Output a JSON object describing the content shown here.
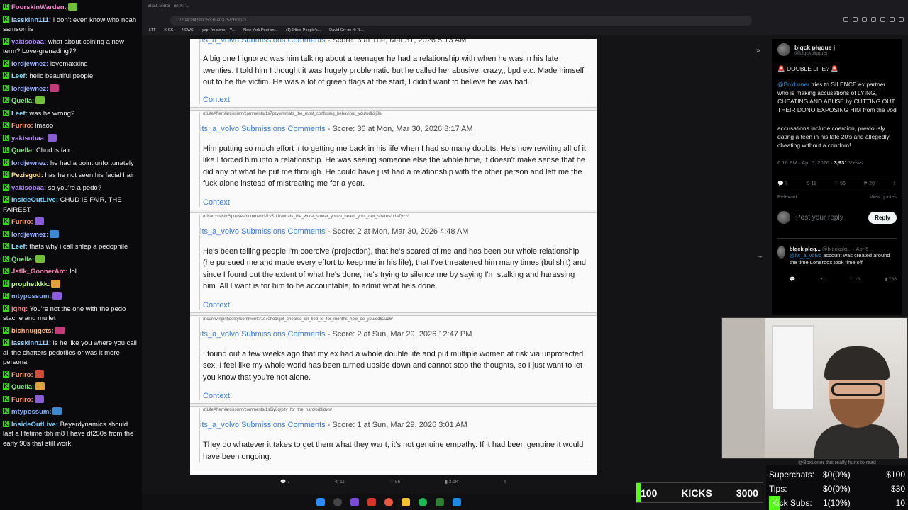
{
  "chat": {
    "messages": [
      {
        "user": "FoorskinWarden",
        "color": "#ff7fd0",
        "text": ""
      },
      {
        "user": "lasskinn111",
        "color": "#9ad0ff",
        "text": "I don't even know who noah samson is"
      },
      {
        "user": "yakisobaa",
        "color": "#b58cff",
        "text": "what about coining a new term? Love-grenading??"
      },
      {
        "user": "lordjewnez",
        "color": "#9ab0ff",
        "text": "lovemaxxing"
      },
      {
        "user": "Leef",
        "color": "#7fe0ff",
        "text": "hello beautiful people"
      },
      {
        "user": "lordjewnez",
        "color": "#9ab0ff",
        "text": ""
      },
      {
        "user": "Quella",
        "color": "#7fe07f",
        "text": ""
      },
      {
        "user": "Leef",
        "color": "#7fe0ff",
        "text": "was he wrong?"
      },
      {
        "user": "Furiro",
        "color": "#ff9a6a",
        "text": "lmaoo"
      },
      {
        "user": "yakisobaa",
        "color": "#b58cff",
        "text": ""
      },
      {
        "user": "Quella",
        "color": "#7fe07f",
        "text": "Chud is fair"
      },
      {
        "user": "lordjewnez",
        "color": "#9ab0ff",
        "text": "he had a point unfortunately"
      },
      {
        "user": "Pezisgod",
        "color": "#ffd97f",
        "text": "has he not seen his facial hair"
      },
      {
        "user": "yakisobaa",
        "color": "#b58cff",
        "text": "so you're a pedo?"
      },
      {
        "user": "InsideOutLive",
        "color": "#6ad0ff",
        "text": "CHUD IS FAIR, THE FAIREST"
      },
      {
        "user": "Furiro",
        "color": "#ff9a6a",
        "text": ""
      },
      {
        "user": "lordjewnez",
        "color": "#9ab0ff",
        "text": ""
      },
      {
        "user": "Leef",
        "color": "#7fe0ff",
        "text": "thats why i call shlep a pedophile"
      },
      {
        "user": "Quella",
        "color": "#7fe07f",
        "text": ""
      },
      {
        "user": "Jstlk_GoonerArc",
        "color": "#ff7fb0",
        "text": "lol"
      },
      {
        "user": "prophetkkk",
        "color": "#c0ff7f",
        "text": ""
      },
      {
        "user": "mtypossum",
        "color": "#7fb0ff",
        "text": ""
      },
      {
        "user": "jqhq",
        "color": "#ff7f7f",
        "text": "You're not the one with the pedo stache and mullet"
      },
      {
        "user": "bichnuggets",
        "color": "#ffb07f",
        "text": ""
      },
      {
        "user": "lasskinn111",
        "color": "#9ad0ff",
        "text": "is he like you where you call all the chatters pedofiles or was it more personal"
      },
      {
        "user": "Furiro",
        "color": "#ff9a6a",
        "text": ""
      },
      {
        "user": "Quella",
        "color": "#7fe07f",
        "text": ""
      },
      {
        "user": "Furiro",
        "color": "#ff9a6a",
        "text": ""
      },
      {
        "user": "mtypossum",
        "color": "#7fb0ff",
        "text": ""
      },
      {
        "user": "InsideOutLive",
        "color": "#6ad0ff",
        "text": "Beyerdynamics should last a lifetime tbh m8 I have dt250s from the early 90s that still work"
      }
    ]
  },
  "browser": {
    "tab_title": "Black Mirror | on X: '...",
    "url": ".../2040841100533940375/photo/3",
    "bookmarks": [
      "LTT",
      "KICK",
      "NEWS",
      "yep, i'm done. - Y...",
      "New York Post on...",
      "(1) Other People's...",
      "David Orr on X: \"L..."
    ]
  },
  "page": {
    "entries": [
      {
        "path": "",
        "author": "its_a_volvo Submissions Comments",
        "meta": "- Score: 3 at Tue, Mar 31, 2026 5:13 AM",
        "body": "A big one I ignored was him talking about a teenager he had a relationship with when he was in his late twenties. I told him I thought it was hugely problematic but he called her abusive, crazy,, bpd etc. Made himself out to be the victim. He was a lot of green flags at the start, I didn't want to believe he was bad.",
        "context": "Context"
      },
      {
        "path": "/r/LifeAfterNarcissism/comments/1s7pzyw/whats_the_most_confusing_behaviour_you/odb2j8h/",
        "author": "its_a_volvo Submissions Comments",
        "meta": "- Score: 36 at Mon, Mar 30, 2026 8:17 AM",
        "body": "Him putting so much effort into getting me back in his life when I had so many doubts. He's now rewiting all of it like I forced him into a relationship. He was seeing someone else the whole time, it doesn't make sense that he did any of what he put me through. He could have just had a relationship with the other person and left me the fuck alone instead of mistreating me for a year.",
        "context": "Context"
      },
      {
        "path": "/r/NarcissisticSpouses/comments/1s51t1r/whats_the_worst_smear_youve_heard_your_nex_shares/oda7yxz/",
        "author": "its_a_volvo Submissions Comments",
        "meta": "- Score: 2 at Mon, Mar 30, 2026 4:48 AM",
        "body": "He's been telling people I'm coercive (projection), that he's scared of me and has been our whole relationship (he pursued me and made every effort to keep me in his life), that I've threatened him many times (bullshit) and since I found out the extent of what he's done, he's trying to silence me by saying I'm stalking and harassing him. All I want is for him to be accountable, to admit what he's done.",
        "context": "Context"
      },
      {
        "path": "/r/survivinginfidelity/comments/1s70ho1/got_cheated_on_lied_to_for_months_how_do_you/od62uq6/",
        "author": "its_a_volvo Submissions Comments",
        "meta": "- Score: 2 at Sun, Mar 29, 2026 12:47 PM",
        "body": "I found out a few weeks ago that my ex had a whole double life and put multiple women at risk via unprotected sex, I feel like my whole world has been turned upside down and cannot stop the thoughts, so I just want to let you know that you're not alone.",
        "context": "Context"
      },
      {
        "path": "/r/LifeAfterNarcissism/comments/1s6iy6q/pity_for_the_narc/od3idwx/",
        "author": "its_a_volvo Submissions Comments",
        "meta": "- Score: 1 at Sun, Mar 29, 2026 3:01 AM",
        "body": "They do whatever it takes to get them what they want, it's not genuine empathy. If it had been genuine it would have been ongoing.",
        "context": ""
      }
    ],
    "actions": {
      "replies": "7",
      "reposts": "11",
      "likes": "56",
      "views": "3.9K"
    }
  },
  "tweet": {
    "name": "blqck plqque j",
    "handle": "@blqckplqquej",
    "headline": "🚨 DOUBLE LIFE? 🚨",
    "mention": "@BoxLoner",
    "body1": " tries to SILENCE ex partner who is making accusations of LYING, CHEATING AND ABUSE by CUTTING OUT THEIR DONO EXPOSING HIM from the vod",
    "body2": "accusations include coercion, previously dating a teen in his late 20's and allegedly cheating without a condom!",
    "time": "6:16 PM · Apr 5, 2026 ·",
    "views_count": "3,931",
    "views_label": "Views",
    "stats": {
      "replies": "7",
      "reposts": "11",
      "likes": "56",
      "bookmarks": "20"
    },
    "relevant": "Relevant",
    "view_quotes": "View quotes",
    "reply_placeholder": "Post your reply",
    "reply_button": "Reply",
    "reply2_name": "blqck plqq...",
    "reply2_handle": "@blqckplq... · Apr 5",
    "reply2_mention": "@its_a_volvo",
    "reply2_text": " account was created around the time Lonerbox took time off",
    "reply2_stats": {
      "replies": "",
      "reposts": "",
      "likes": "16",
      "views": "738"
    }
  },
  "cam_caption": "@BoxLoner this really hurts to read",
  "kick_bar": {
    "left": "100",
    "label": "KICKS",
    "right": "3000",
    "progress": 0.033
  },
  "stats": [
    {
      "label": "Superchats:",
      "value": "$0(0%)",
      "goal": "$100"
    },
    {
      "label": "Tips:",
      "value": "$0(0%)",
      "goal": "$30"
    },
    {
      "label": "Kick Subs:",
      "value": "1(10%)",
      "goal": "10"
    }
  ],
  "colors": {
    "kick_green": "#53fc18",
    "link_blue": "#3a7bd5",
    "x_blue": "#1d9bf0"
  }
}
